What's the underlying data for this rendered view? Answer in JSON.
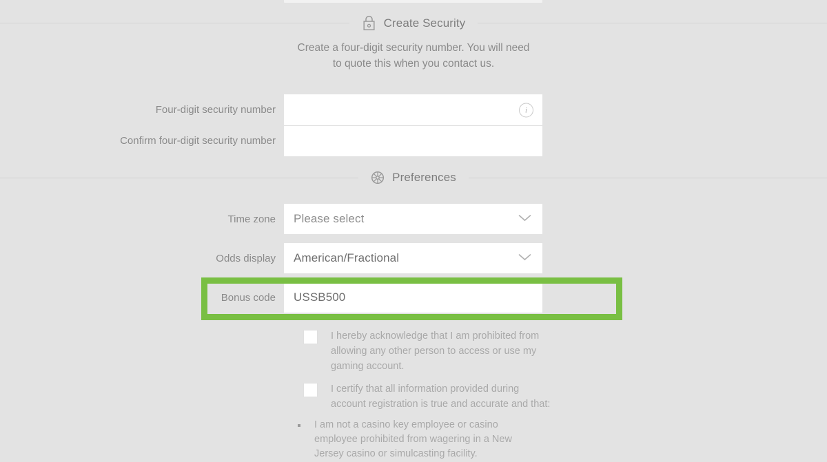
{
  "theme": {
    "page_background": "#e3e3e3",
    "field_background": "#ffffff",
    "highlight_green": "#79bf43",
    "label_color": "#8a8a8a",
    "muted_text": "#a9a9a9",
    "divider": "#d3d3d3"
  },
  "sections": {
    "security": {
      "title": "Create Security",
      "icon": "lock-icon",
      "description_line1": "Create a four-digit security number. You will need",
      "description_line2": "to quote this when you contact us.",
      "fields": [
        {
          "label": "Four-digit security number",
          "value": "",
          "placeholder": "",
          "has_info_icon": true
        },
        {
          "label": "Confirm four-digit security number",
          "value": "",
          "placeholder": "",
          "has_info_icon": false
        }
      ]
    },
    "preferences": {
      "title": "Preferences",
      "icon": "wheel-icon",
      "selects": [
        {
          "label": "Time zone",
          "value": "Please select",
          "is_placeholder": true,
          "chevron": "chevron-down-icon"
        },
        {
          "label": "Odds display",
          "value": "American/Fractional",
          "is_placeholder": false,
          "chevron": "chevron-down-icon"
        }
      ],
      "bonus_code": {
        "label": "Bonus code",
        "value": "USSB500",
        "highlighted": true
      }
    },
    "agreements": {
      "checkboxes": [
        {
          "checked": false,
          "text": "I hereby acknowledge that I am prohibited from allowing any other person to access or use my gaming account."
        },
        {
          "checked": false,
          "text": "I certify that all information provided during account registration is true and accurate and that:"
        }
      ],
      "bullets": [
        "I am not a casino key employee or casino employee prohibited from wagering in a New Jersey casino or simulcasting facility."
      ]
    }
  }
}
